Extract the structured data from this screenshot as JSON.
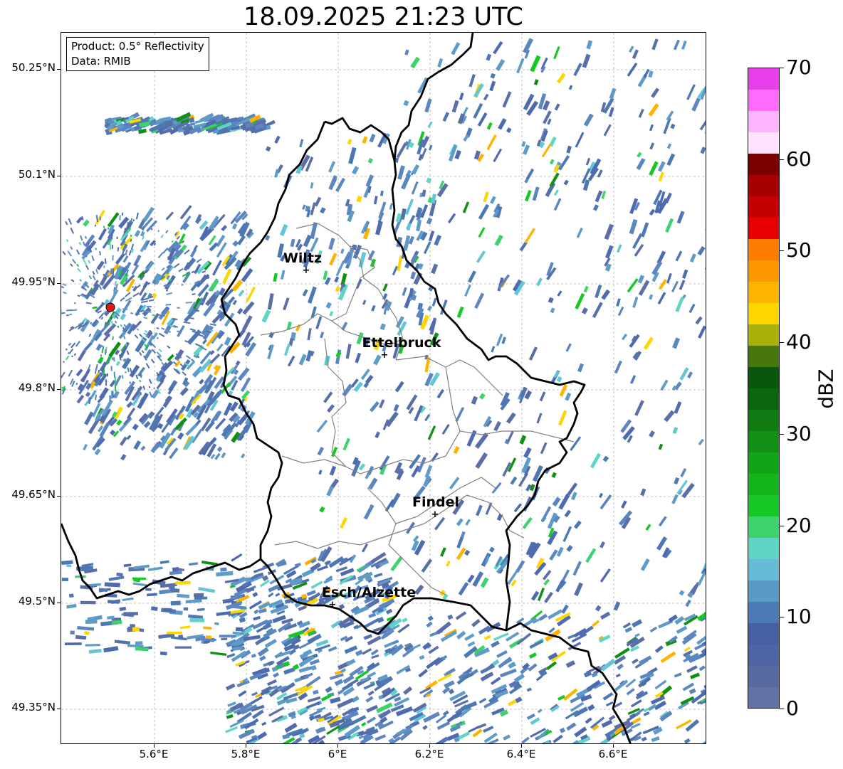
{
  "title": "18.09.2025 21:23 UTC",
  "info_box": {
    "product": "Product: 0.5° Reflectivity",
    "data_source": "Data: RMIB"
  },
  "lat_labels": [
    "50.25°N",
    "50.1°N",
    "49.95°N",
    "49.8°N",
    "49.65°N",
    "49.5°N",
    "49.35°N"
  ],
  "lon_labels": [
    "5.6°E",
    "5.8°E",
    "6°E",
    "6.2°E",
    "6.4°E",
    "6.6°E"
  ],
  "cities": [
    {
      "name": "Wiltz"
    },
    {
      "name": "Ettelbruck"
    },
    {
      "name": "Findel"
    },
    {
      "name": "Esch/Alzette"
    }
  ],
  "colorbar": {
    "unit": "dBZ",
    "tick_labels": [
      "0",
      "10",
      "20",
      "30",
      "40",
      "50",
      "60",
      "70"
    ],
    "min": 0,
    "max": 70,
    "step": 2.5,
    "colors": [
      "#6272a4",
      "#566a9f",
      "#4e64a4",
      "#475fa3",
      "#4a7bb5",
      "#5a9ac7",
      "#66bcd8",
      "#5fd6c4",
      "#3dd36c",
      "#16c825",
      "#14b51c",
      "#12a418",
      "#129016",
      "#0f7b12",
      "#0c6610",
      "#08570d",
      "#48780c",
      "#a9b00a",
      "#fdd600",
      "#fdb400",
      "#fd9800",
      "#fd7d00",
      "#e80000",
      "#c40000",
      "#a60000",
      "#7a0000",
      "#ffe2ff",
      "#ffb4ff",
      "#ff6bff",
      "#e83fea"
    ]
  },
  "radar_site": {
    "color": "#e01a1a"
  }
}
